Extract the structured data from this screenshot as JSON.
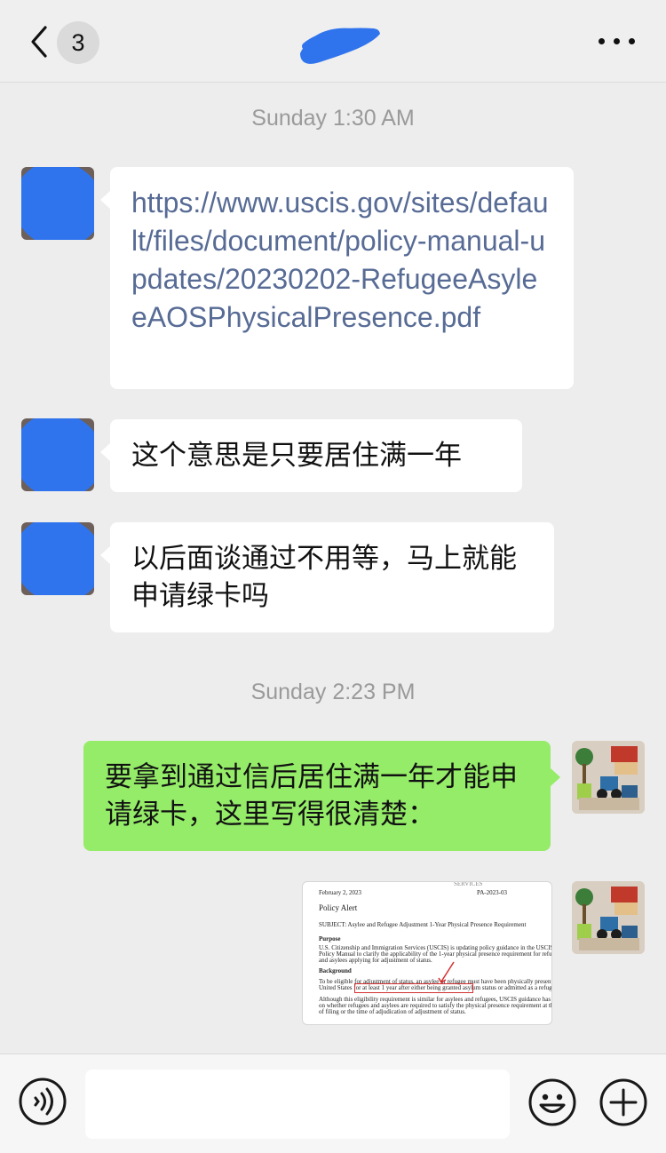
{
  "header": {
    "back_label": "<",
    "unread_count": "3",
    "more_label": "..."
  },
  "messages": [
    {
      "type": "timestamp",
      "text": "Sunday 1:30 AM"
    },
    {
      "type": "incoming",
      "kind": "link",
      "text": "https://www.uscis.gov/sites/default/files/document/policy-manual-updates/20230202-RefugeeAsyleeAOSPhysicalPresence.pdf"
    },
    {
      "type": "incoming",
      "kind": "text",
      "text": "这个意思是只要居住满一年"
    },
    {
      "type": "incoming",
      "kind": "text",
      "text": "以后面谈通过不用等，马上就能申请绿卡吗"
    },
    {
      "type": "timestamp",
      "text": "Sunday 2:23 PM"
    },
    {
      "type": "outgoing",
      "kind": "text",
      "text": "要拿到通过信后居住满一年才能申请绿卡，这里写得很清楚："
    },
    {
      "type": "outgoing",
      "kind": "image",
      "doc": {
        "date": "February 2, 2023",
        "number": "PA-2023-03",
        "title": "Policy Alert",
        "subject": "SUBJECT:   Asylee and Refugee Adjustment 1-Year Physical Presence Requirement",
        "purpose_heading": "Purpose",
        "purpose_text_1": "U.S. Citizenship and Immigration Services (USCIS) is updating policy guidance in the USCIS",
        "purpose_text_2": "Policy Manual to clarify the applicability of the 1-year physical presence requirement for refugees",
        "purpose_text_3": "and asylees applying for adjustment of status.",
        "background_heading": "Background",
        "background_text_1": "To be eligible for adjustment of status, an asylee or refugee must have been physically present in the",
        "background_text_2": "United States for at least 1 year after either being granted asylum status or admitted as a refugee.",
        "background_text_3": "Although this eligibility requirement is similar for asylees and refugees, USCIS guidance has differed",
        "background_text_4": "on whether refugees and asylees are required to satisfy the physical presence requirement at the time",
        "background_text_5": "of filing or the time of adjudication of adjustment of status.",
        "highlight_color": "#d33030"
      }
    }
  ],
  "input": {
    "value": "",
    "placeholder": ""
  },
  "colors": {
    "outgoing_bubble": "#95ec69",
    "incoming_bubble": "#ffffff",
    "link": "#576b95",
    "background": "#ededed",
    "redaction": "#2f74ec"
  },
  "icons": {
    "voice": "voice-icon",
    "emoji": "emoji-icon",
    "plus": "plus-icon"
  }
}
